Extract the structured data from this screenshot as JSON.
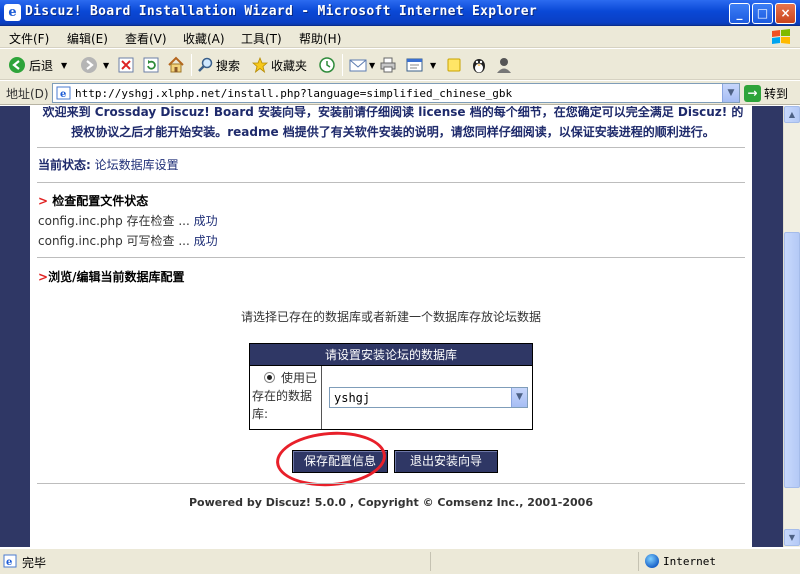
{
  "window": {
    "title": "Discuz! Board Installation Wizard - Microsoft Internet Explorer",
    "app_icon_glyph": "e",
    "controls": {
      "minimize": "_",
      "maximize": "□",
      "close": "×"
    }
  },
  "menu": [
    "文件(F)",
    "编辑(E)",
    "查看(V)",
    "收藏(A)",
    "工具(T)",
    "帮助(H)"
  ],
  "toolbar": {
    "back": "后退",
    "search": "搜索",
    "favorites": "收藏夹"
  },
  "address": {
    "label": "地址(D)",
    "url": "http://yshgj.xlphp.net/install.php?language=simplified_chinese_gbk",
    "go": "转到"
  },
  "page": {
    "intro_line1": "欢迎来到 Crossday Discuz! Board 安装向导，安装前请仔细阅读 license 档的每个细节，在您确定可以完全满足 Discuz! 的",
    "intro_line2": "授权协议之后才能开始安装。readme 档提供了有关软件安装的说明，请您同样仔细阅读，以保证安装进程的顺利进行。",
    "status_label": "当前状态:",
    "status_value": "论坛数据库设置",
    "section1_marker": ">",
    "section1_title": "检查配置文件状态",
    "check1_text": "config.inc.php 存在检查 ... ",
    "check1_result": "成功",
    "check2_text": "config.inc.php 可写检查 ... ",
    "check2_result": "成功",
    "section2_marker": ">",
    "section2_title": "浏览/编辑当前数据库配置",
    "prompt": "请选择已存在的数据库或者新建一个数据库存放论坛数据",
    "db_table_header": "请设置安装论坛的数据库",
    "db_option_label": "使用已存在的数据库:",
    "db_selected": "yshgj",
    "save_button": "保存配置信息",
    "exit_button": "退出安装向导",
    "footer": "Powered by Discuz! 5.0.0 ,  Copyright © Comsenz Inc., 2001-2006"
  },
  "statusbar": {
    "status": "完毕",
    "zone": "Internet"
  },
  "colors": {
    "page_background": "#2f3765",
    "accent_red": "#e02020",
    "link_blue": "#1f2f77",
    "annotation_red": "#e8202a"
  }
}
